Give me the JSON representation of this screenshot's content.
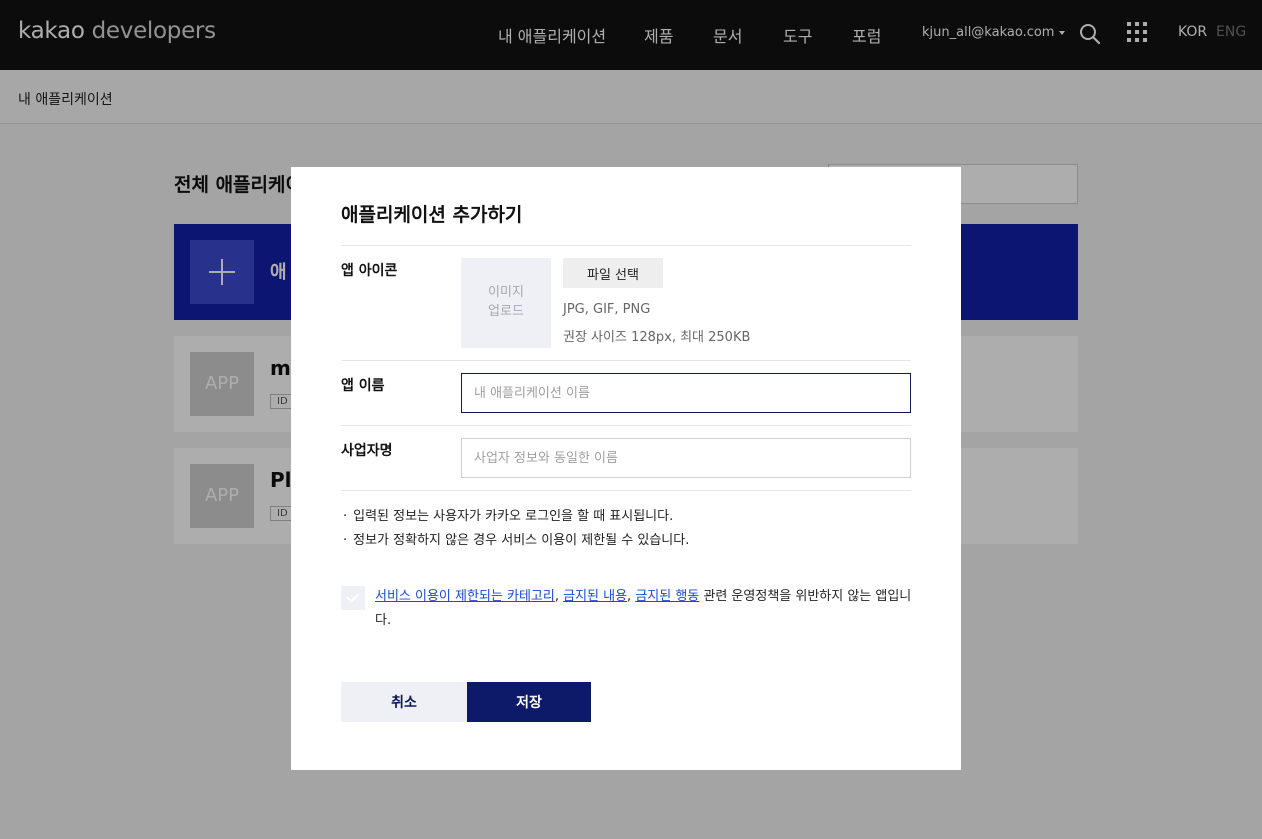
{
  "header": {
    "logo_brand": "kakao",
    "logo_product": "developers",
    "nav": [
      "내 애플리케이션",
      "제품",
      "문서",
      "도구",
      "포럼"
    ],
    "account": "kjun_all@kakao.com",
    "lang_kor": "KOR",
    "lang_eng": "ENG",
    "icons": {
      "search": "search-icon",
      "apps": "apps-grid-icon",
      "caret": "caret-down-icon"
    }
  },
  "breadcrumb": "내 애플리케이션",
  "background": {
    "title": "전체 애플리케이",
    "add_card_label": "애",
    "apps": [
      {
        "thumb": "APP",
        "name": "m",
        "id": "ID"
      },
      {
        "thumb": "APP",
        "name": "Pl",
        "id": "ID"
      }
    ]
  },
  "modal": {
    "title": "애플리케이션 추가하기",
    "icon_label": "앱 아이콘",
    "image_upload_line1": "이미지",
    "image_upload_line2": "업로드",
    "file_button": "파일 선택",
    "hint_formats": "JPG, GIF, PNG",
    "hint_size": "권장 사이즈 128px, 최대 250KB",
    "app_name_label": "앱 이름",
    "app_name_placeholder": "내 애플리케이션 이름",
    "company_label": "사업자명",
    "company_placeholder": "사업자 정보와 동일한 이름",
    "notes": [
      "입력된 정보는 사용자가 카카오 로그인을 할 때 표시됩니다.",
      "정보가 정확하지 않은 경우 서비스 이용이 제한될 수 있습니다."
    ],
    "agree_link1": "서비스 이용이 제한되는 카테고리",
    "agree_link2": "금지된 내용",
    "agree_link3": "금지된 행동",
    "agree_sep": ", ",
    "agree_tail": " 관련 운영정책을 위반하지 않는 앱입니다.",
    "cancel_button": "취소",
    "save_button": "저장"
  },
  "colors": {
    "header_bg": "#131313",
    "primary": "#0d1a6a",
    "add_card": "#1220a8",
    "link": "#1a4bd6"
  }
}
